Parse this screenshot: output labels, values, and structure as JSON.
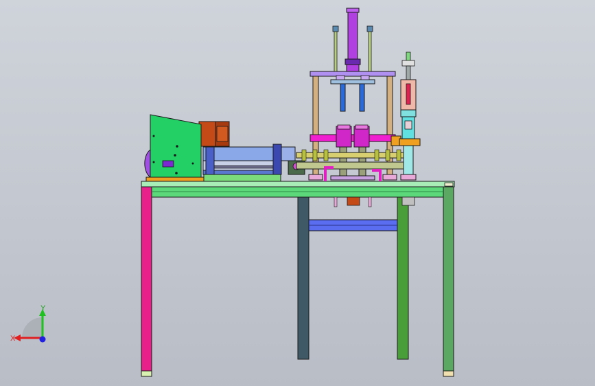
{
  "viewport": {
    "background_top": "#cfd3da",
    "background_bottom": "#b9bdc6"
  },
  "colors": {
    "frame_outline": "#1a1a1a",
    "table_top": "#5cd87a",
    "leg_left": "#e8208a",
    "leg_dark": "#3f5a66",
    "leg_green": "#4a9e3a",
    "leg_right": "#5aa862",
    "crossbar": "#5a6cf0",
    "cover_plate": "#22d066",
    "motor": "#c44a18",
    "cylinder_purple": "#b040e0",
    "cylinder_blue": "#2a6ad8",
    "magenta": "#f020d0",
    "rod_tan": "#d4b080",
    "accent_orange": "#f0a020",
    "slide_blue": "#8aa8e8",
    "aqua": "#60e0e0"
  },
  "triad": {
    "x_label": "X",
    "y_label": "Y",
    "x_color": "#e02020",
    "y_color": "#20c020",
    "z_color": "#2020e0"
  }
}
